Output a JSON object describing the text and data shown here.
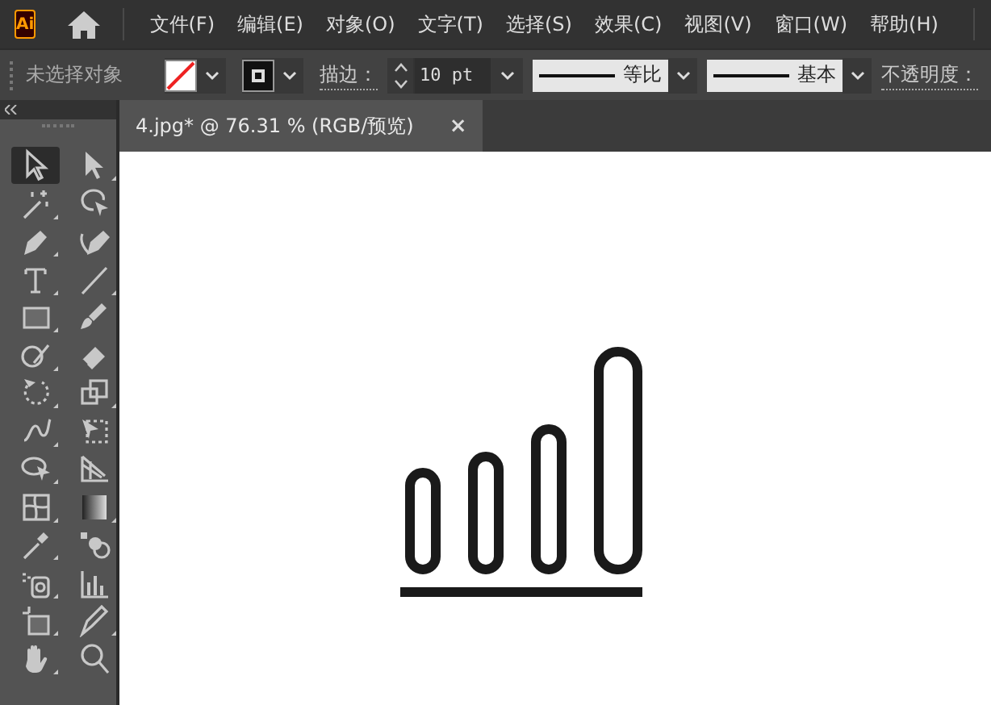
{
  "app": {
    "logo": "Ai"
  },
  "menu": [
    {
      "label": "文件(F)"
    },
    {
      "label": "编辑(E)"
    },
    {
      "label": "对象(O)"
    },
    {
      "label": "文字(T)"
    },
    {
      "label": "选择(S)"
    },
    {
      "label": "效果(C)"
    },
    {
      "label": "视图(V)"
    },
    {
      "label": "窗口(W)"
    },
    {
      "label": "帮助(H)"
    }
  ],
  "control_bar": {
    "selection": "未选择对象",
    "stroke_label": "描边：",
    "stroke_weight": "10 pt",
    "profile": "等比",
    "brush": "基本",
    "opacity_label": "不透明度："
  },
  "document_tab": {
    "title": "4.jpg* @ 76.31 % (RGB/预览)",
    "close": "×",
    "selected": true
  },
  "tools": [
    {
      "selected": true
    },
    {
      "selected": false
    },
    {
      "selected": false
    },
    {
      "selected": false
    },
    {
      "selected": false
    },
    {
      "selected": false
    },
    {
      "selected": false
    },
    {
      "selected": false
    },
    {
      "selected": false
    },
    {
      "selected": false
    },
    {
      "selected": false
    },
    {
      "selected": false
    },
    {
      "selected": false
    },
    {
      "selected": false
    },
    {
      "selected": false
    },
    {
      "selected": false
    },
    {
      "selected": false
    },
    {
      "selected": false
    },
    {
      "selected": false
    },
    {
      "selected": false
    },
    {
      "selected": false
    },
    {
      "selected": false
    },
    {
      "selected": false
    },
    {
      "selected": false
    },
    {
      "selected": false
    },
    {
      "selected": false
    },
    {
      "selected": false
    },
    {
      "selected": false
    }
  ]
}
